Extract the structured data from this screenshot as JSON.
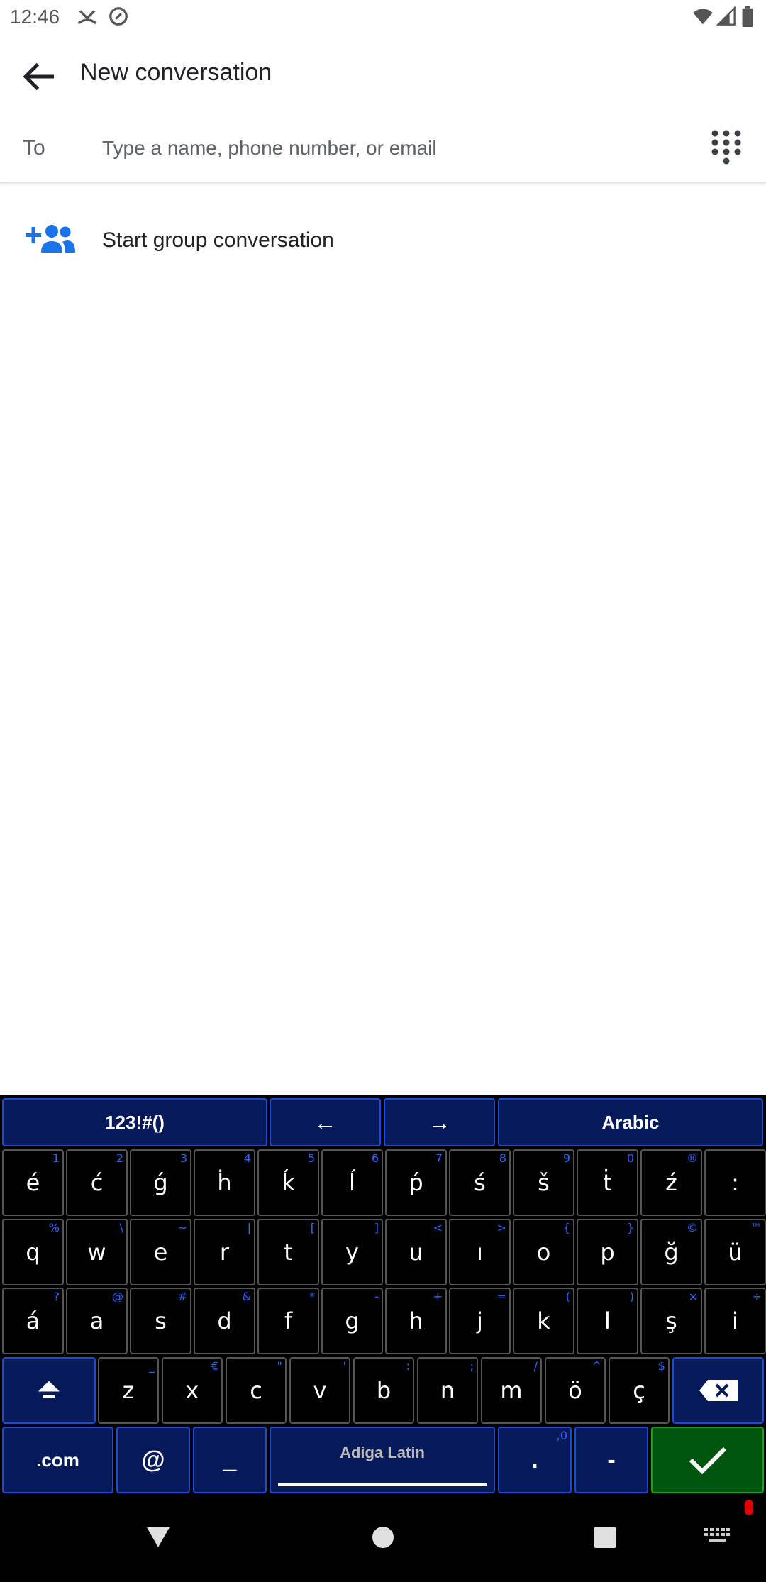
{
  "status_bar": {
    "time": "12:46"
  },
  "app_bar": {
    "title": "New conversation"
  },
  "to_row": {
    "label": "To",
    "placeholder": "Type a name, phone number, or email"
  },
  "group_row": {
    "label": "Start group conversation"
  },
  "keyboard": {
    "top_row": {
      "symbols": "123!#()",
      "left_arrow": "←",
      "right_arrow": "→",
      "language": "Arabic"
    },
    "row1": [
      {
        "k": "é",
        "h": "1"
      },
      {
        "k": "ć",
        "h": "2"
      },
      {
        "k": "ǵ",
        "h": "3"
      },
      {
        "k": "ḣ",
        "h": "4"
      },
      {
        "k": "ḱ",
        "h": "5"
      },
      {
        "k": "ĺ",
        "h": "6"
      },
      {
        "k": "ṕ",
        "h": "7"
      },
      {
        "k": "ś",
        "h": "8"
      },
      {
        "k": "š",
        "h": "9"
      },
      {
        "k": "ṫ",
        "h": "0"
      },
      {
        "k": "ź",
        "h": "®"
      },
      {
        "k": ":",
        "h": ""
      }
    ],
    "row2": [
      {
        "k": "q",
        "h": "%"
      },
      {
        "k": "w",
        "h": "\\"
      },
      {
        "k": "e",
        "h": "~"
      },
      {
        "k": "r",
        "h": "|"
      },
      {
        "k": "t",
        "h": "["
      },
      {
        "k": "y",
        "h": "]"
      },
      {
        "k": "u",
        "h": "<"
      },
      {
        "k": "ı",
        "h": ">"
      },
      {
        "k": "o",
        "h": "{"
      },
      {
        "k": "p",
        "h": "}"
      },
      {
        "k": "ğ",
        "h": "©"
      },
      {
        "k": "ü",
        "h": "™"
      }
    ],
    "row3": [
      {
        "k": "á",
        "h": "?"
      },
      {
        "k": "a",
        "h": "@"
      },
      {
        "k": "s",
        "h": "#"
      },
      {
        "k": "d",
        "h": "&"
      },
      {
        "k": "f",
        "h": "*"
      },
      {
        "k": "g",
        "h": "-"
      },
      {
        "k": "h",
        "h": "+"
      },
      {
        "k": "j",
        "h": "="
      },
      {
        "k": "k",
        "h": "("
      },
      {
        "k": "l",
        "h": ")"
      },
      {
        "k": "ş",
        "h": "×"
      },
      {
        "k": "i",
        "h": "÷"
      }
    ],
    "row4": [
      {
        "k": "z",
        "h": "_"
      },
      {
        "k": "x",
        "h": "€"
      },
      {
        "k": "c",
        "h": "\""
      },
      {
        "k": "v",
        "h": "'"
      },
      {
        "k": "b",
        "h": ":"
      },
      {
        "k": "n",
        "h": ";"
      },
      {
        "k": "m",
        "h": "/"
      },
      {
        "k": "ö",
        "h": "^"
      },
      {
        "k": "ç",
        "h": "$"
      }
    ],
    "bottom_row": {
      "dotcom": ".com",
      "at": "@",
      "underscore": "_",
      "space_label": "Adiga Latin",
      "period": ".",
      "period_hint": ",0",
      "dash": "-"
    },
    "colors": {
      "key_blue": "#061a59",
      "hint_blue": "#2d66ff",
      "enter_green": "#00550f"
    }
  },
  "icons": [
    "back-arrow-icon",
    "dialpad-icon",
    "group-add-icon",
    "shift-icon",
    "backspace-icon",
    "check-icon",
    "nav-back-icon",
    "nav-home-icon",
    "nav-recents-icon",
    "keyboard-icon"
  ]
}
